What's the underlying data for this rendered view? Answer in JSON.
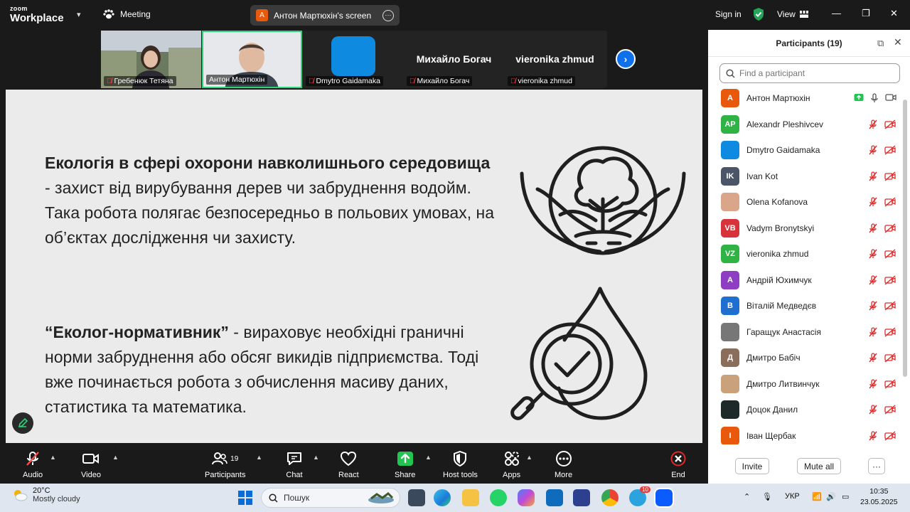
{
  "topbar": {
    "brand_small": "zoom",
    "brand_large": "Workplace",
    "meeting_label": "Meeting",
    "screen_share_initial": "A",
    "screen_share_label": "Антон Мартюхін's screen",
    "signin": "Sign in",
    "view": "View"
  },
  "thumbnails": [
    {
      "name": "Гребенюк Тетяна"
    },
    {
      "name": "Антон Мартюхін"
    },
    {
      "name": "Dmytro Gaidamaka"
    },
    {
      "name": "Михайло Богач",
      "display": "Михайло Богач"
    },
    {
      "name": "vieronika zhmud",
      "display": "vieronika zhmud"
    }
  ],
  "slide": {
    "p1_bold": "Екологія в сфері охорони навколишнього середовища",
    "p1_rest": " - захист від вирубування дерев чи забруднення водойм. Така робота полягає безпосередньо в польових умовах, на об’єктах дослідження чи захисту.",
    "p2_bold": "“Еколог-нормативник”",
    "p2_rest": " - вираховує необхідні граничні норми забруднення або обсяг викидів підприємства. Тоді вже починається робота з обчислення масиву даних, статистика та математика."
  },
  "toolbar": {
    "audio": "Audio",
    "video": "Video",
    "participants": "Participants",
    "participants_count": "19",
    "chat": "Chat",
    "react": "React",
    "share": "Share",
    "host_tools": "Host tools",
    "apps": "Apps",
    "more": "More",
    "end": "End"
  },
  "panel": {
    "title": "Participants (19)",
    "search_placeholder": "Find a participant",
    "invite": "Invite",
    "mute_all": "Mute all",
    "more": "···",
    "participants": [
      {
        "initials": "A",
        "name": "Антон Мартюхін",
        "color": "#e8590c"
      },
      {
        "initials": "AP",
        "name": "Alexandr Pleshivcev",
        "color": "#2fb344"
      },
      {
        "initials": "",
        "name": "Dmytro Gaidamaka",
        "color": "#0e8ae0"
      },
      {
        "initials": "IK",
        "name": "Ivan Kot",
        "color": "#4a5568"
      },
      {
        "initials": "",
        "name": "Olena Kofanova",
        "color": "#d9a58b"
      },
      {
        "initials": "VB",
        "name": "Vadym Bronytskyi",
        "color": "#d6333a"
      },
      {
        "initials": "VZ",
        "name": "vieronika zhmud",
        "color": "#2fb344"
      },
      {
        "initials": "А",
        "name": "Андрій Юхимчук",
        "color": "#8e3ec2"
      },
      {
        "initials": "В",
        "name": "Віталій Медведєв",
        "color": "#1f6fd1"
      },
      {
        "initials": "",
        "name": "Гаращук Анастасія",
        "color": "#777777"
      },
      {
        "initials": "Д",
        "name": "Дмитро Бабіч",
        "color": "#8a6d5a"
      },
      {
        "initials": "",
        "name": "Дмитро Литвинчук",
        "color": "#c9a27c"
      },
      {
        "initials": "",
        "name": "Доцок Данил",
        "color": "#1e2a2a"
      },
      {
        "initials": "І",
        "name": "Іван Щербак",
        "color": "#e8590c"
      }
    ]
  },
  "taskbar": {
    "temp": "20°C",
    "weather": "Mostly cloudy",
    "search": "Пошук",
    "lang": "УКР",
    "time": "10:35",
    "date": "23.05.2025",
    "telegram_badge": "10"
  }
}
